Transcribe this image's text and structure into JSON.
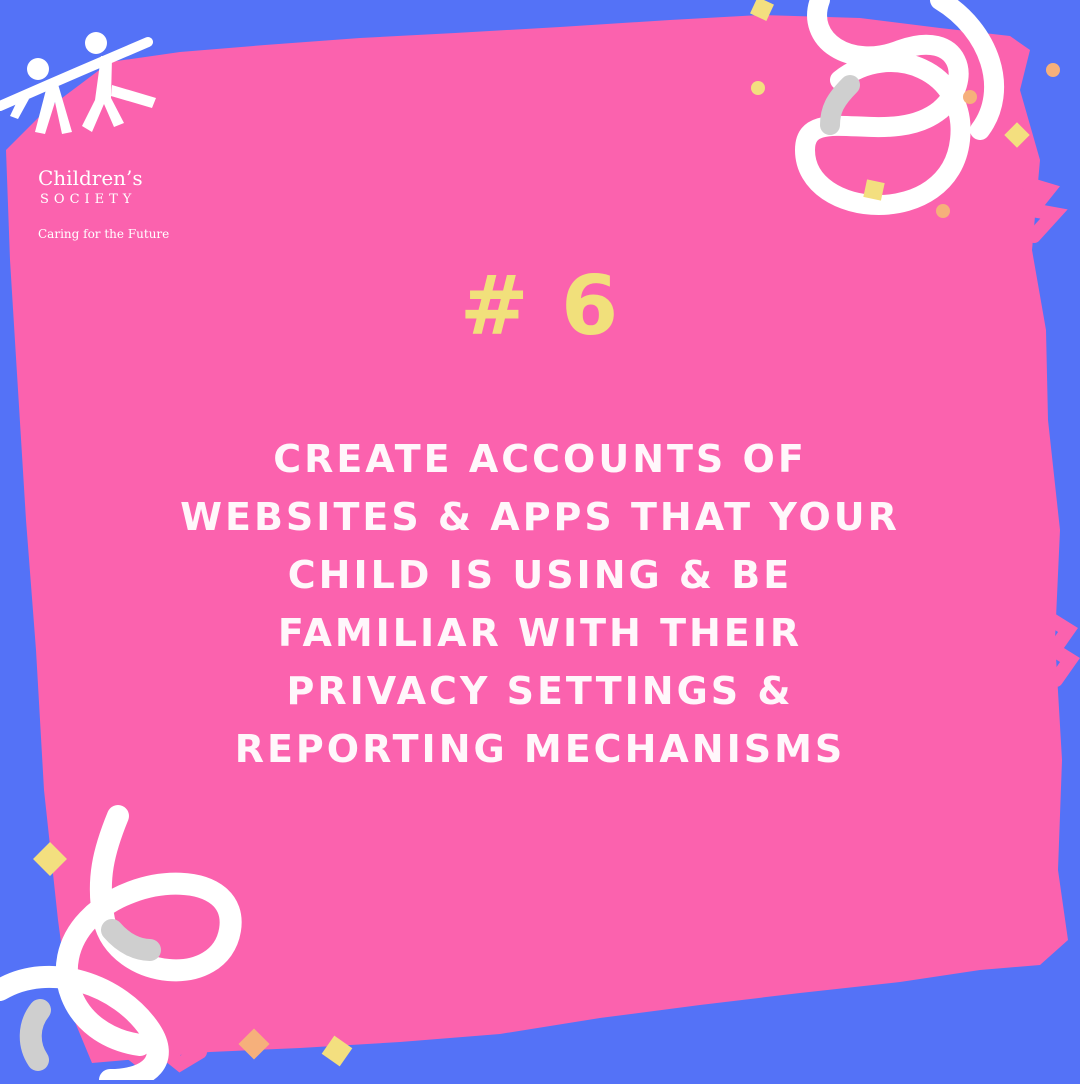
{
  "brand": {
    "name": "Children’s",
    "subname": "SOCIETY",
    "tagline": "Caring for the Future"
  },
  "tip": {
    "number": "# 6",
    "text": "CREATE ACCOUNTS OF WEBSITES & APPS THAT YOUR CHILD IS USING & BE FAMILIAR WITH THEIR PRIVACY SETTINGS & REPORTING MECHANISMS"
  },
  "colors": {
    "background": "#5472f7",
    "panel": "#fb62ae",
    "accent": "#f1e07b",
    "text": "#ffffff"
  },
  "decorations": {
    "logo_icon": "two-children-holding-hands-icon",
    "confetti_icon": "confetti-icon",
    "streamer_icon": "streamer-icon"
  }
}
